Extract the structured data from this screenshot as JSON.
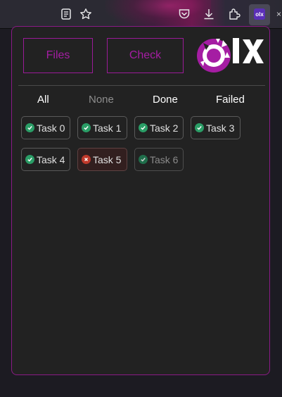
{
  "toolbar": {
    "icons": [
      "reader-view-icon",
      "bookmark-star-icon",
      "pocket-icon",
      "download-icon",
      "extensions-icon",
      "olx-extension-icon",
      "overflow-icon"
    ],
    "extension_badge": "olx"
  },
  "popup": {
    "buttons": {
      "files": "Files",
      "check": "Check"
    },
    "logo_text": "olx",
    "filters": [
      {
        "label": "All",
        "active": true
      },
      {
        "label": "None",
        "active": false
      },
      {
        "label": "Done",
        "active": true
      },
      {
        "label": "Failed",
        "active": true
      }
    ],
    "tasks": [
      {
        "label": "Task 0",
        "status": "done"
      },
      {
        "label": "Task 1",
        "status": "done"
      },
      {
        "label": "Task 2",
        "status": "done"
      },
      {
        "label": "Task 3",
        "status": "done"
      },
      {
        "label": "Task 4",
        "status": "done"
      },
      {
        "label": "Task 5",
        "status": "failed"
      },
      {
        "label": "Task 6",
        "status": "done-dim"
      }
    ]
  },
  "colors": {
    "accent": "#9b1b98",
    "success": "#2a9d66",
    "failure": "#c0392b",
    "panel_bg": "#222222"
  }
}
